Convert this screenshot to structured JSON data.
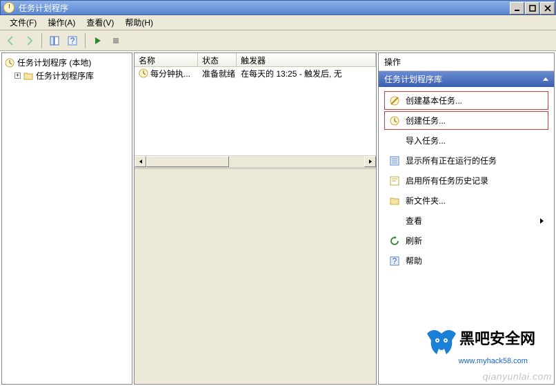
{
  "window": {
    "title": "任务计划程序"
  },
  "menu": {
    "file": "文件(F)",
    "action": "操作(A)",
    "view": "查看(V)",
    "help": "帮助(H)"
  },
  "tree": {
    "root": "任务计划程序 (本地)",
    "library": "任务计划程序库"
  },
  "list": {
    "columns": {
      "name": "名称",
      "state": "状态",
      "trigger": "触发器"
    },
    "rows": [
      {
        "name": "每分钟执...",
        "state": "准备就绪",
        "trigger": "在每天的 13:25 - 触发后, 无"
      }
    ]
  },
  "actions": {
    "title": "操作",
    "section": "任务计划程序库",
    "items": {
      "create_basic": "创建基本任务...",
      "create_task": "创建任务...",
      "import_task": "导入任务...",
      "show_running": "显示所有正在运行的任务",
      "enable_history": "启用所有任务历史记录",
      "new_folder": "新文件夹...",
      "view": "查看",
      "refresh": "刷新",
      "help": "帮助"
    }
  },
  "watermarks": {
    "site_name": "黑吧安全网",
    "site_url": "www.myhack58.com",
    "footer": "qianyunlai.com"
  }
}
